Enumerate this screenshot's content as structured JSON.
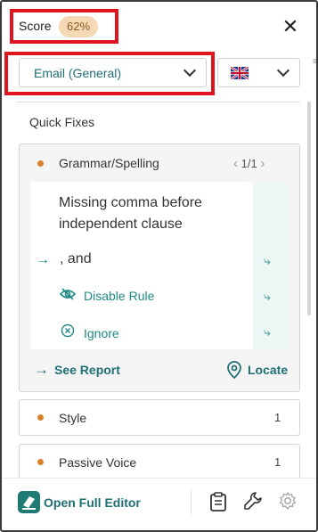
{
  "header": {
    "score_label": "Score",
    "score_value": "62%",
    "close_icon": "close-icon"
  },
  "selectors": {
    "style_value": "Email (General)",
    "language_flag": "uk-flag-icon"
  },
  "quick_fixes": {
    "title": "Quick Fixes",
    "card": {
      "category": "Grammar/Spelling",
      "pager": "1/1",
      "message": "Missing comma before independent clause",
      "suggestion": ", and",
      "actions": [
        {
          "label": "Disable Rule",
          "icon": "eye-off-icon"
        },
        {
          "label": "Ignore",
          "icon": "x-circle-icon"
        }
      ],
      "see_report": "See Report",
      "locate": "Locate"
    },
    "rows": [
      {
        "label": "Style",
        "count": "1"
      },
      {
        "label": "Passive Voice",
        "count": "1"
      }
    ]
  },
  "footer": {
    "open_editor": "Open Full Editor",
    "icons": [
      "clipboard-icon",
      "wrench-icon",
      "gear-icon"
    ]
  },
  "colors": {
    "accent": "#1f6f74",
    "teal_text": "#1f8a84",
    "dot_orange": "#d9822b",
    "score_badge_bg": "#f4d9b4",
    "highlight_red": "#e0141e"
  }
}
